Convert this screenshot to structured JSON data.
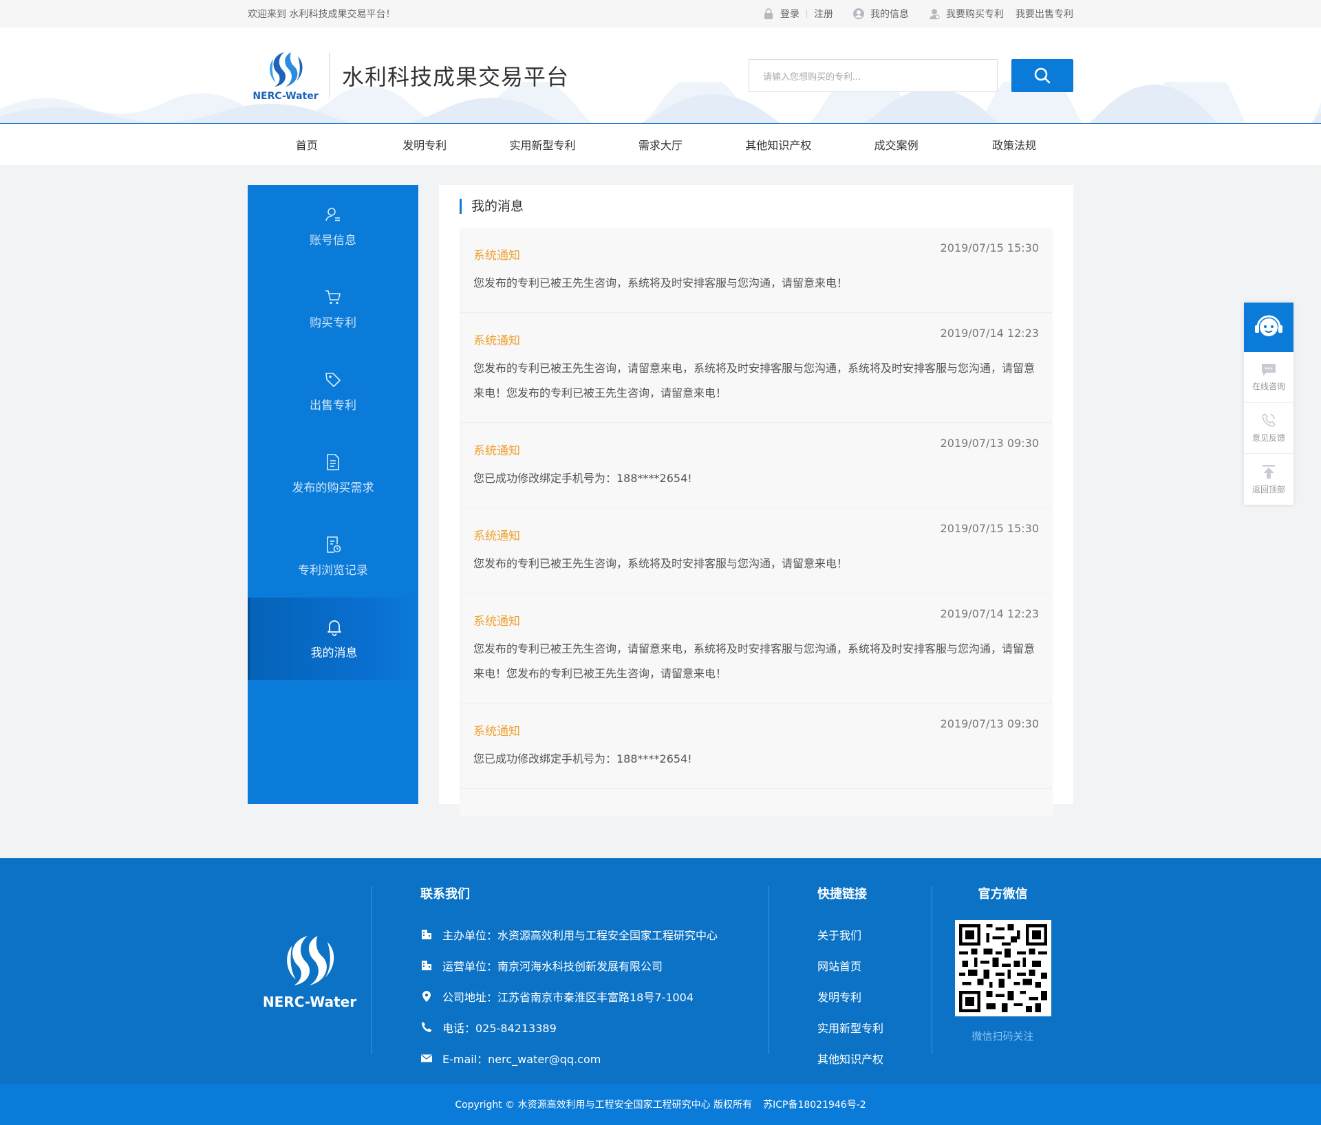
{
  "topbar": {
    "welcome": "欢迎来到  水利科技成果交易平台！",
    "login": "登录",
    "register": "注册",
    "my_info": "我的信息",
    "buy_patent": "我要购买专利",
    "sell_patent": "我要出售专利"
  },
  "header": {
    "logo_text": "NERC-Water",
    "site_title": "水利科技成果交易平台",
    "search_placeholder": "请输入您想购买的专利..."
  },
  "nav": {
    "items": [
      {
        "label": "首页"
      },
      {
        "label": "发明专利"
      },
      {
        "label": "实用新型专利"
      },
      {
        "label": "需求大厅"
      },
      {
        "label": "其他知识产权"
      },
      {
        "label": "成交案例"
      },
      {
        "label": "政策法规"
      }
    ]
  },
  "sidebar": {
    "items": [
      {
        "label": "账号信息",
        "icon": "user-icon"
      },
      {
        "label": "购买专利",
        "icon": "cart-icon"
      },
      {
        "label": "出售专利",
        "icon": "tag-icon"
      },
      {
        "label": "发布的购买需求",
        "icon": "document-icon"
      },
      {
        "label": "专利浏览记录",
        "icon": "history-icon"
      },
      {
        "label": "我的消息",
        "icon": "bell-icon",
        "active": true
      }
    ]
  },
  "content": {
    "title": "我的消息",
    "messages": [
      {
        "title": "系统通知",
        "date": "2019/07/15 15:30",
        "text": "您发布的专利已被王先生咨询，系统将及时安排客服与您沟通，请留意来电！"
      },
      {
        "title": "系统通知",
        "date": "2019/07/14 12:23",
        "text": "您发布的专利已被王先生咨询，请留意来电，系统将及时安排客服与您沟通，系统将及时安排客服与您沟通，请留意来电！您发布的专利已被王先生咨询，请留意来电！"
      },
      {
        "title": "系统通知",
        "date": "2019/07/13 09:30",
        "text": "您已成功修改绑定手机号为：188****2654!"
      },
      {
        "title": "系统通知",
        "date": "2019/07/15 15:30",
        "text": "您发布的专利已被王先生咨询，系统将及时安排客服与您沟通，请留意来电！"
      },
      {
        "title": "系统通知",
        "date": "2019/07/14 12:23",
        "text": "您发布的专利已被王先生咨询，请留意来电，系统将及时安排客服与您沟通，系统将及时安排客服与您沟通，请留意来电！您发布的专利已被王先生咨询，请留意来电！"
      },
      {
        "title": "系统通知",
        "date": "2019/07/13 09:30",
        "text": "您已成功修改绑定手机号为：188****2654!"
      }
    ]
  },
  "float": {
    "online": "在线咨询",
    "feedback": "意见反馈",
    "top": "返回顶部"
  },
  "footer": {
    "logo_text": "NERC-Water",
    "contact_title": "联系我们",
    "contact": [
      {
        "icon": "building-icon",
        "text": "主办单位：水资源高效利用与工程安全国家工程研究中心"
      },
      {
        "icon": "building-icon",
        "text": "运营单位：南京河海水科技创新发展有限公司"
      },
      {
        "icon": "location-icon",
        "text": "公司地址：江苏省南京市秦淮区丰富路18号7-1004"
      },
      {
        "icon": "phone-icon",
        "text": "电话：025-84213389"
      },
      {
        "icon": "mail-icon",
        "text": "E-mail：nerc_water@qq.com"
      }
    ],
    "links_title": "快捷链接",
    "links": [
      {
        "label": "关于我们"
      },
      {
        "label": "网站首页"
      },
      {
        "label": "发明专利"
      },
      {
        "label": "实用新型专利"
      },
      {
        "label": "其他知识产权"
      }
    ],
    "wechat_title": "官方微信",
    "wechat_note": "微信扫码关注",
    "copyright": "Copyright © 水资源高效利用与工程安全国家工程研究中心 版权所有",
    "icp": "苏ICP备18021946号-2"
  },
  "colors": {
    "primary": "#0a7bd8",
    "footer": "#0b72c6",
    "notice": "#f0a030"
  }
}
